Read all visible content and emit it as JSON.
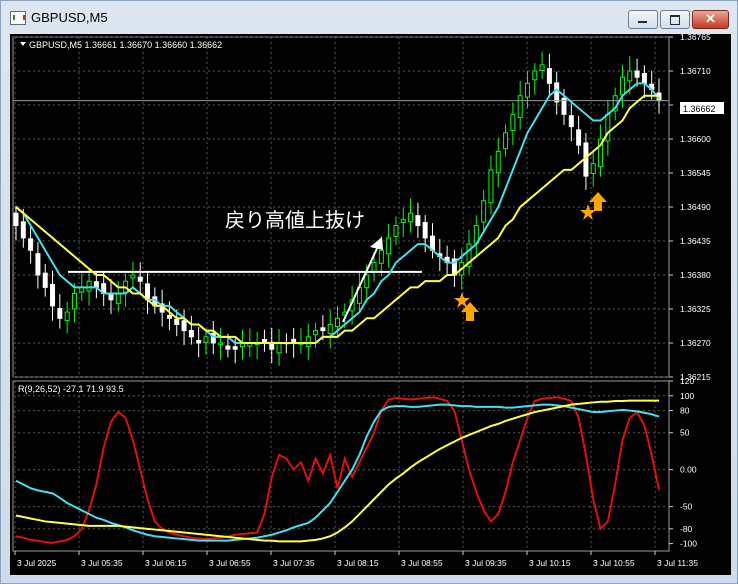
{
  "window": {
    "title": "GBPUSD,M5"
  },
  "main_chart": {
    "header": "GBPUSD,M5  1.36661 1.36670 1.36660 1.36662",
    "price_axis": [
      "1.36765",
      "1.36710",
      "1.36655",
      "1.36600",
      "1.36545",
      "1.36490",
      "1.36435",
      "1.36380",
      "1.36325",
      "1.36270",
      "1.36215"
    ],
    "current_price": "1.36662",
    "annotation": "戻り高値上抜け"
  },
  "indicator": {
    "header": "R(9,26,52) -27.1 71.9 93.5",
    "axis": [
      "120",
      "100",
      "80",
      "50",
      "0.00",
      "-50",
      "-80",
      "-100"
    ]
  },
  "time_axis": [
    "3 Jul 2025",
    "3 Jul 05:35",
    "3 Jul 06:15",
    "3 Jul 06:55",
    "3 Jul 07:35",
    "3 Jul 08:15",
    "3 Jul 08:55",
    "3 Jul 09:35",
    "3 Jul 10:15",
    "3 Jul 10:55",
    "3 Jul 11:35"
  ],
  "colors": {
    "bull": "#00ff00",
    "bear": "#ffffff",
    "ma_fast": "#40e0f0",
    "ma_slow": "#ffff40",
    "osc_fast": "#e01010",
    "signal_arrow": "#ffa500",
    "grid": "#5a5a5a"
  },
  "signals": [
    {
      "icon": "orange-up-arrow-icon",
      "marker": "orange-star-icon",
      "time": "3 Jul 09:35"
    },
    {
      "icon": "orange-up-arrow-icon",
      "marker": "orange-star-icon",
      "time": "3 Jul 10:55"
    }
  ],
  "chart_data": [
    {
      "type": "candlestick",
      "title": "GBPUSD,M5",
      "ylim": [
        1.36215,
        1.36765
      ],
      "x_labels": [
        "3 Jul 2025",
        "3 Jul 05:35",
        "3 Jul 06:15",
        "3 Jul 06:55",
        "3 Jul 07:35",
        "3 Jul 08:15",
        "3 Jul 08:55",
        "3 Jul 09:35",
        "3 Jul 10:15",
        "3 Jul 10:55",
        "3 Jul 11:35"
      ],
      "close": [
        1.3646,
        1.3644,
        1.3642,
        1.3638,
        1.3636,
        1.3633,
        1.3631,
        1.3632,
        1.3635,
        1.3636,
        1.3637,
        1.3636,
        1.3635,
        1.3634,
        1.3635,
        1.3637,
        1.3638,
        1.3637,
        1.3634,
        1.3633,
        1.3632,
        1.3631,
        1.363,
        1.3629,
        1.3628,
        1.3627,
        1.3628,
        1.3627,
        1.3627,
        1.3626,
        1.3626,
        1.3627,
        1.3627,
        1.3627,
        1.3627,
        1.3626,
        1.3627,
        1.3627,
        1.3627,
        1.3627,
        1.3628,
        1.3629,
        1.3629,
        1.363,
        1.3631,
        1.3632,
        1.3634,
        1.3636,
        1.3638,
        1.364,
        1.3642,
        1.3644,
        1.3646,
        1.3647,
        1.3648,
        1.3646,
        1.3644,
        1.3642,
        1.3641,
        1.364,
        1.3638,
        1.364,
        1.3643,
        1.3646,
        1.365,
        1.3655,
        1.3658,
        1.3661,
        1.3664,
        1.3667,
        1.3669,
        1.3671,
        1.3672,
        1.3669,
        1.3666,
        1.3664,
        1.3662,
        1.3659,
        1.3654,
        1.3656,
        1.366,
        1.3664,
        1.3667,
        1.367,
        1.3671,
        1.367,
        1.3669,
        1.3668,
        1.36662
      ],
      "series": [
        {
          "name": "MA fast",
          "color": "#40e0f0",
          "values": [
            1.3649,
            1.3648,
            1.3646,
            1.3644,
            1.3642,
            1.364,
            1.3638,
            1.3637,
            1.3636,
            1.3636,
            1.3636,
            1.3636,
            1.3635,
            1.3635,
            1.3635,
            1.3635,
            1.3636,
            1.3635,
            1.3634,
            1.3634,
            1.3633,
            1.3633,
            1.3632,
            1.3631,
            1.363,
            1.363,
            1.3629,
            1.3628,
            1.3628,
            1.3628,
            1.3627,
            1.3627,
            1.3627,
            1.3627,
            1.3627,
            1.3627,
            1.3627,
            1.3627,
            1.3627,
            1.3627,
            1.3627,
            1.3627,
            1.3628,
            1.3628,
            1.3629,
            1.363,
            1.3631,
            1.3632,
            1.3634,
            1.3635,
            1.3637,
            1.3638,
            1.364,
            1.3641,
            1.3642,
            1.3643,
            1.3643,
            1.3642,
            1.3641,
            1.364,
            1.364,
            1.3641,
            1.3642,
            1.3643,
            1.3645,
            1.3647,
            1.3649,
            1.3652,
            1.3655,
            1.3658,
            1.3661,
            1.3663,
            1.3665,
            1.3667,
            1.3668,
            1.3667,
            1.3666,
            1.3665,
            1.3664,
            1.3663,
            1.3663,
            1.3664,
            1.3665,
            1.3667,
            1.3668,
            1.3669,
            1.3669,
            1.3668,
            1.36665
          ]
        },
        {
          "name": "MA slow",
          "color": "#ffff40",
          "values": [
            1.3649,
            1.3648,
            1.3647,
            1.3646,
            1.3645,
            1.3644,
            1.3643,
            1.3642,
            1.3641,
            1.364,
            1.3639,
            1.3638,
            1.3638,
            1.3637,
            1.3636,
            1.3636,
            1.3635,
            1.3635,
            1.3634,
            1.3633,
            1.3633,
            1.3632,
            1.3631,
            1.3631,
            1.363,
            1.363,
            1.3629,
            1.3629,
            1.3628,
            1.3628,
            1.3628,
            1.3627,
            1.3627,
            1.3627,
            1.3627,
            1.3627,
            1.3627,
            1.3627,
            1.3627,
            1.3627,
            1.3627,
            1.3627,
            1.3628,
            1.3628,
            1.3628,
            1.3629,
            1.3629,
            1.363,
            1.3631,
            1.3631,
            1.3632,
            1.3633,
            1.3634,
            1.3635,
            1.3636,
            1.3636,
            1.3637,
            1.3637,
            1.3637,
            1.3638,
            1.3638,
            1.3639,
            1.364,
            1.3641,
            1.3642,
            1.3643,
            1.3644,
            1.3646,
            1.3647,
            1.3649,
            1.365,
            1.3651,
            1.3652,
            1.3653,
            1.3654,
            1.3655,
            1.3655,
            1.3656,
            1.3657,
            1.3658,
            1.3659,
            1.3661,
            1.3662,
            1.3663,
            1.3665,
            1.3666,
            1.3667,
            1.3667,
            1.3667
          ]
        }
      ],
      "hline": 1.36385
    },
    {
      "type": "line",
      "title": "R(9,26,52)",
      "ylim": [
        -110,
        120
      ],
      "series": [
        {
          "name": "R(9)",
          "color": "#e01010",
          "values": [
            -90,
            -92,
            -95,
            -96,
            -98,
            -99,
            -97,
            -95,
            -90,
            -80,
            -55,
            -20,
            30,
            65,
            78,
            70,
            40,
            0,
            -40,
            -70,
            -80,
            -85,
            -88,
            -90,
            -92,
            -93,
            -94,
            -93,
            -92,
            -90,
            -88,
            -87,
            -86,
            -85,
            -60,
            -10,
            20,
            15,
            0,
            10,
            -15,
            15,
            -5,
            20,
            -25,
            15,
            -10,
            10,
            30,
            50,
            80,
            95,
            97,
            96,
            95,
            96,
            97,
            98,
            96,
            93,
            80,
            40,
            0,
            -30,
            -55,
            -70,
            -60,
            -30,
            10,
            40,
            70,
            93,
            96,
            97,
            98,
            96,
            93,
            70,
            20,
            -40,
            -80,
            -70,
            -20,
            40,
            70,
            78,
            60,
            20,
            -27.1
          ]
        },
        {
          "name": "R(26)",
          "color": "#40e0f0",
          "values": [
            -15,
            -20,
            -25,
            -28,
            -30,
            -32,
            -38,
            -45,
            -50,
            -55,
            -60,
            -65,
            -68,
            -72,
            -75,
            -78,
            -82,
            -85,
            -88,
            -90,
            -91,
            -92,
            -93,
            -94,
            -95,
            -96,
            -96,
            -96,
            -96,
            -96,
            -95,
            -94,
            -93,
            -92,
            -90,
            -88,
            -85,
            -82,
            -78,
            -75,
            -72,
            -65,
            -55,
            -45,
            -30,
            -15,
            0,
            20,
            45,
            65,
            80,
            85,
            86,
            86,
            85,
            85,
            86,
            87,
            88,
            88,
            87,
            86,
            86,
            85,
            85,
            85,
            85,
            84,
            84,
            85,
            86,
            87,
            88,
            88,
            87,
            86,
            84,
            82,
            80,
            78,
            78,
            79,
            80,
            81,
            80,
            79,
            77,
            75,
            71.9
          ]
        },
        {
          "name": "R(52)",
          "color": "#ffff40",
          "values": [
            -62,
            -64,
            -66,
            -68,
            -70,
            -71,
            -72,
            -73,
            -74,
            -75,
            -76,
            -76,
            -76,
            -76,
            -76,
            -77,
            -78,
            -79,
            -80,
            -81,
            -82,
            -83,
            -84,
            -85,
            -86,
            -87,
            -88,
            -89,
            -90,
            -91,
            -92,
            -93,
            -94,
            -95,
            -96,
            -96,
            -97,
            -97,
            -97,
            -97,
            -96,
            -95,
            -93,
            -90,
            -85,
            -78,
            -70,
            -60,
            -50,
            -40,
            -30,
            -20,
            -12,
            -5,
            3,
            10,
            16,
            22,
            28,
            33,
            38,
            43,
            47,
            51,
            55,
            59,
            62,
            66,
            69,
            72,
            75,
            78,
            80,
            82,
            84,
            86,
            88,
            89,
            90,
            91,
            92,
            92,
            93,
            93,
            93.5,
            93.5,
            93.5,
            93.5,
            93.5
          ]
        }
      ]
    }
  ]
}
